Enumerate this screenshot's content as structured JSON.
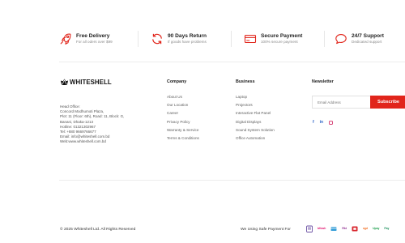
{
  "colors": {
    "accent": "#e1251b",
    "text": "#222222",
    "muted": "#8a8a8a",
    "divider": "#e7e7e7"
  },
  "features": [
    {
      "icon": "rocket-icon",
      "title": "Free Delivery",
      "subtitle": "For all oders over $99"
    },
    {
      "icon": "refresh-icon",
      "title": "90 Days Return",
      "subtitle": "If goods have problems"
    },
    {
      "icon": "credit-card-icon",
      "title": "Secure Payment",
      "subtitle": "100% secure payment"
    },
    {
      "icon": "chat-bubble-icon",
      "title": "24/7 Support",
      "subtitle": "Dedicated support"
    }
  ],
  "brand": {
    "name": "WHITESHELL",
    "address_lines": [
      "Head Office:",
      "Concord Modhumoti Plaza,",
      "Plot: 11 (Floor: 6th), Road: 11, Block: G,",
      "Banani, Dhaka-1213",
      "Hotline: 01321302967",
      "Tel: +880 9669766677",
      "Email: info@whiteshell.com.bd",
      "Web:www.whiteshell.com.bd"
    ]
  },
  "company": {
    "title": "Company",
    "links": [
      "About Us",
      "Our Location",
      "Career",
      "Privacy Policy",
      "Warranty & Service",
      "Terms & Conditions"
    ]
  },
  "business": {
    "title": "Business",
    "links": [
      "Laptop",
      "Projectors",
      "Interactive Flat Panel",
      "Digital Displays",
      "Sound System Solution",
      "Office Automation"
    ]
  },
  "newsletter": {
    "title": "Newsletter",
    "placeholder": "Email Address",
    "button_label": "Subscribe",
    "socials": [
      {
        "icon": "facebook-icon",
        "glyph": "f"
      },
      {
        "icon": "linkedin-icon",
        "glyph": "in"
      },
      {
        "icon": "instagram-icon",
        "glyph": ""
      }
    ]
  },
  "footer": {
    "copyright": "© 2025 Whiteshell Ltd. All Rights Reserved",
    "safe_payment_label": "We Using Safe Payment For",
    "payment_methods": [
      {
        "icon": "cash-on-delivery-icon",
        "color": "#6a4fa3"
      },
      {
        "icon": "bkash-icon",
        "label": "bKash",
        "color": "#e2136e"
      },
      {
        "icon": "card-icon",
        "color": "#3aa0d8"
      },
      {
        "icon": "rocket-pay-icon",
        "label": "Rkt",
        "color": "#8c2a8f"
      },
      {
        "icon": "dbbl-icon",
        "color": "#d9262e"
      },
      {
        "icon": "nagad-icon",
        "label": "ngd",
        "color": "#f26d21"
      },
      {
        "icon": "upay-icon",
        "label": "Upay",
        "color": "#1b9e4b"
      },
      {
        "icon": "pay-wallet-icon",
        "label": "Pay",
        "color": "#1a8f5c"
      }
    ]
  }
}
